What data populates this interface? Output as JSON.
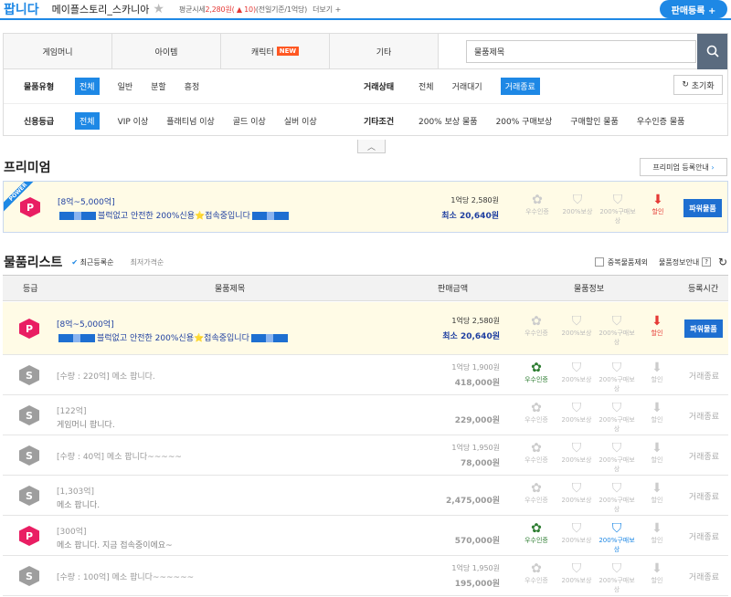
{
  "header": {
    "logo": "팝니다",
    "game_name": "메이플스토리_스카니아",
    "price_label": "평균시세",
    "price_value": "2,280원",
    "price_change": "( ▲ 10)",
    "price_note": "(전일기준/1억당)",
    "more": "더보기 +",
    "sell_button": "판매등록 +"
  },
  "tabs": [
    "게임머니",
    "아이템",
    "캐릭터",
    "기타"
  ],
  "tab_new_badge": "NEW",
  "search": {
    "value": "물품제목"
  },
  "filters": {
    "type_label": "물품유형",
    "type_options": [
      "전체",
      "일반",
      "분할",
      "흥정"
    ],
    "status_label": "거래상태",
    "status_options": [
      "전체",
      "거래대기",
      "거래종료"
    ],
    "reset": "초기화",
    "credit_label": "신용등급",
    "credit_options": [
      "전체",
      "VIP 이상",
      "플래티넘 이상",
      "골드 이상",
      "실버 이상"
    ],
    "etc_label": "기타조건",
    "etc_options": [
      "200% 보상 물품",
      "200% 구매보상",
      "구매할인 물품",
      "우수인증 물품"
    ]
  },
  "premium": {
    "title": "프리미엄",
    "register": "프리미엄 등록안내",
    "badge": "POWER",
    "item": {
      "line1": "[8억~5,000억]",
      "line2": "블럭없고 안전한 200%신용⭐접속중입니다",
      "rate": "1억당 2,580원",
      "min": "최소 20,640원",
      "btn": "파워물품"
    }
  },
  "list": {
    "title": "물품리스트",
    "sort_recent": "최근등록순",
    "sort_price": "최저가격순",
    "exclude_dup": "중복물품제외",
    "info_guide": "물품정보안내",
    "columns": [
      "등급",
      "물품제목",
      "판매금액",
      "물품정보",
      "등록시간"
    ]
  },
  "icon_labels": [
    "우수인증",
    "200%보상",
    "200%구매보상",
    "할인"
  ],
  "rows": [
    {
      "grade": "P",
      "l1": "[8억~5,000억]",
      "l2": "블럭없고 안전한 200%신용⭐접속중입니다",
      "rate": "1억당 2,580원",
      "total": "최소 20,640원",
      "status": "파워물품",
      "hot": true
    },
    {
      "grade": "S",
      "l1": "[수량 : 220억] 메소 팝니다.",
      "l2": "",
      "rate": "1억당 1,900원",
      "total": "418,000원",
      "status": "거래종료"
    },
    {
      "grade": "S",
      "l1": "[122억]",
      "l2": "게임머니 팝니다.",
      "rate": "",
      "total": "229,000원",
      "status": "거래종료"
    },
    {
      "grade": "S",
      "l1": "[수량 : 40억] 메소 팝니다~~~~~",
      "l2": "",
      "rate": "1억당 1,950원",
      "total": "78,000원",
      "status": "거래종료"
    },
    {
      "grade": "S",
      "l1": "[1,303억]",
      "l2": "메소 팝니다.",
      "rate": "",
      "total": "2,475,000원",
      "status": "거래종료"
    },
    {
      "grade": "P",
      "l1": "[300억]",
      "l2": "메소 팝니다. 지금 접속중이에요~",
      "rate": "",
      "total": "570,000원",
      "status": "거래종료"
    },
    {
      "grade": "S",
      "l1": "[수량 : 100억] 메소 팝니다~~~~~~",
      "l2": "",
      "rate": "1억당 1,950원",
      "total": "195,000원",
      "status": "거래종료"
    }
  ]
}
